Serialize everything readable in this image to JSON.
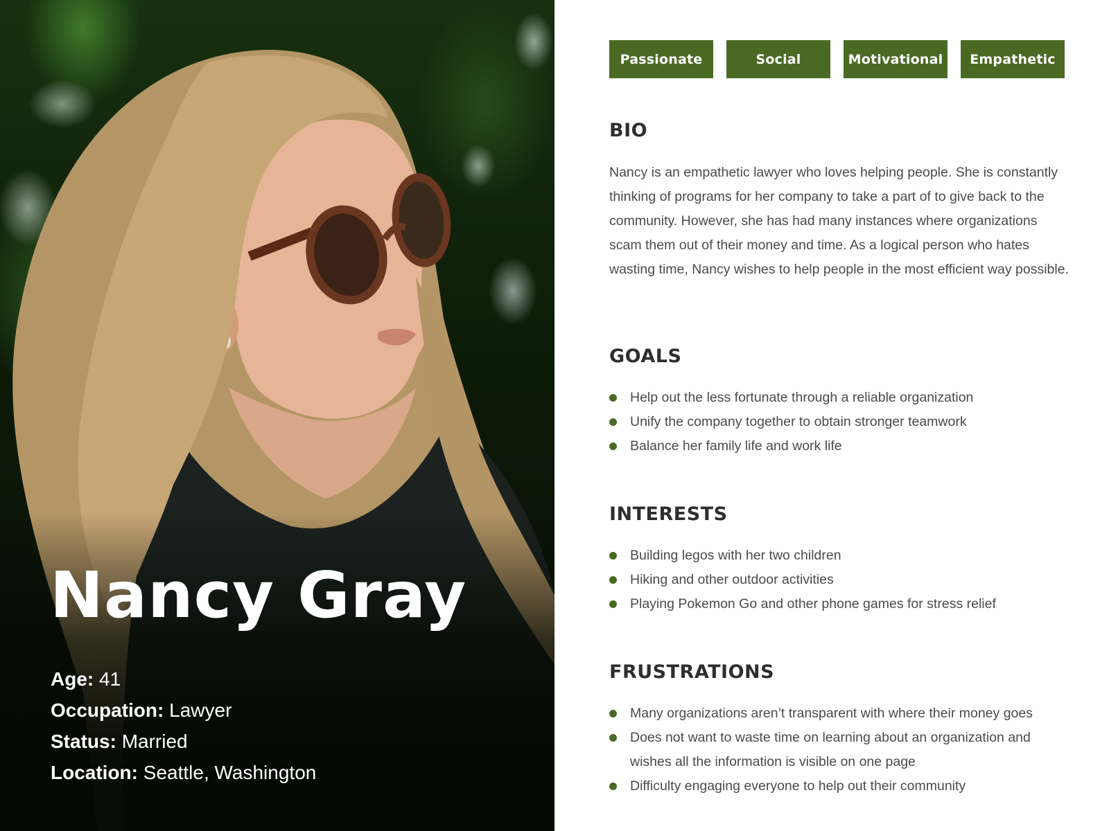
{
  "colors": {
    "accent": "#4a6a24",
    "heading": "#2e2e2e",
    "body_text": "#4a4a4a",
    "name_text": "#ffffff"
  },
  "persona": {
    "name": "Nancy Gray",
    "facts": [
      {
        "label": "Age:",
        "value": "41"
      },
      {
        "label": "Occupation:",
        "value": "Lawyer"
      },
      {
        "label": "Status:",
        "value": "Married"
      },
      {
        "label": "Location:",
        "value": "Seattle, Washington"
      }
    ]
  },
  "traits": [
    "Passionate",
    "Social",
    "Motivational",
    "Empathetic"
  ],
  "bio": {
    "title": "BIO",
    "text": "Nancy is an empathetic lawyer who loves helping people. She is constantly thinking of programs for her company to take a part of to give back to the community. However, she has had many instances where organizations scam them out of their money and time. As a logical person who hates wasting time, Nancy wishes to help people in the most efficient way possible."
  },
  "goals": {
    "title": "GOALS",
    "items": [
      "Help out the less fortunate through a reliable organization",
      "Unify the company together to obtain stronger teamwork",
      "Balance her family life and work life"
    ]
  },
  "interests": {
    "title": "INTERESTS",
    "items": [
      "Building legos with her two children",
      "Hiking and other outdoor activities",
      "Playing Pokemon Go and other phone games for stress relief"
    ]
  },
  "frustrations": {
    "title": "FRUSTRATIONS",
    "items": [
      "Many organizations aren’t transparent with where their money goes",
      "Does not want to waste time on learning about an organization and wishes all the information is visible on one page",
      "Difficulty engaging everyone to help out their community"
    ]
  }
}
